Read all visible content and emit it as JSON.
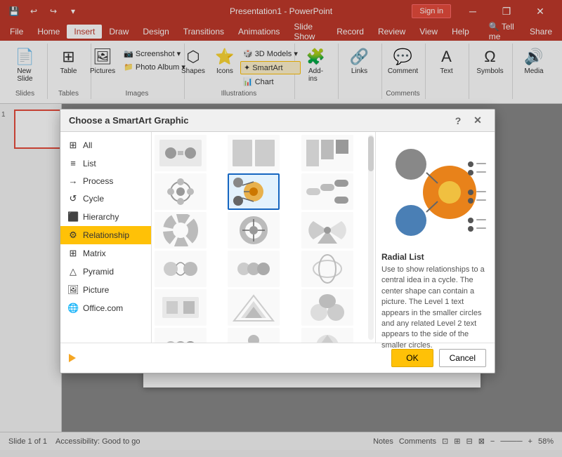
{
  "titleBar": {
    "title": "Presentation1 - PowerPoint",
    "signIn": "Sign in",
    "qat": [
      "↩",
      "↪",
      "💾",
      "⚡"
    ]
  },
  "menuBar": {
    "items": [
      "File",
      "Home",
      "Insert",
      "Draw",
      "Design",
      "Transitions",
      "Animations",
      "Slide Show",
      "Record",
      "Review",
      "View",
      "Help",
      "Tell me",
      "Share"
    ]
  },
  "ribbon": {
    "activeTab": "Insert",
    "groups": [
      {
        "label": "Slides",
        "items": [
          "New Slide"
        ]
      },
      {
        "label": "Tables",
        "items": [
          "Table"
        ]
      },
      {
        "label": "Images",
        "items": [
          "Pictures",
          "Screenshot",
          "Photo Album"
        ]
      },
      {
        "label": "Illustrations",
        "items": [
          "Shapes",
          "Icons",
          "3D Models",
          "SmartArt",
          "Chart"
        ]
      },
      {
        "label": "Add-ins",
        "items": [
          "Add-ins"
        ]
      },
      {
        "label": "",
        "items": [
          "Links"
        ]
      },
      {
        "label": "Comments",
        "items": [
          "Comment"
        ]
      },
      {
        "label": "",
        "items": [
          "Text"
        ]
      },
      {
        "label": "",
        "items": [
          "Symbols"
        ]
      },
      {
        "label": "",
        "items": [
          "Media"
        ]
      }
    ]
  },
  "dialog": {
    "title": "Choose a SmartArt Graphic",
    "categories": [
      {
        "id": "all",
        "label": "All",
        "icon": "⊞"
      },
      {
        "id": "list",
        "label": "List",
        "icon": "≡"
      },
      {
        "id": "process",
        "label": "Process",
        "icon": "→"
      },
      {
        "id": "cycle",
        "label": "Cycle",
        "icon": "↺"
      },
      {
        "id": "hierarchy",
        "label": "Hierarchy",
        "icon": "⬛"
      },
      {
        "id": "relationship",
        "label": "Relationship",
        "icon": "⚙"
      },
      {
        "id": "matrix",
        "label": "Matrix",
        "icon": "⊞"
      },
      {
        "id": "pyramid",
        "label": "Pyramid",
        "icon": "△"
      },
      {
        "id": "picture",
        "label": "Picture",
        "icon": "🖼"
      },
      {
        "id": "office",
        "label": "Office.com",
        "icon": "🌐"
      }
    ],
    "selectedCategory": "relationship",
    "preview": {
      "name": "Radial List",
      "description": "Use to show relationships to a central idea in a cycle. The center shape can contain a picture. The Level 1 text appears in the smaller circles and any related Level 2 text appears to the side of the smaller circles."
    },
    "buttons": {
      "ok": "OK",
      "cancel": "Cancel"
    }
  },
  "statusBar": {
    "slide": "Slide 1 of 1",
    "accessibility": "Accessibility: Good to go",
    "notes": "Notes",
    "comments": "Comments",
    "zoom": "58%"
  }
}
